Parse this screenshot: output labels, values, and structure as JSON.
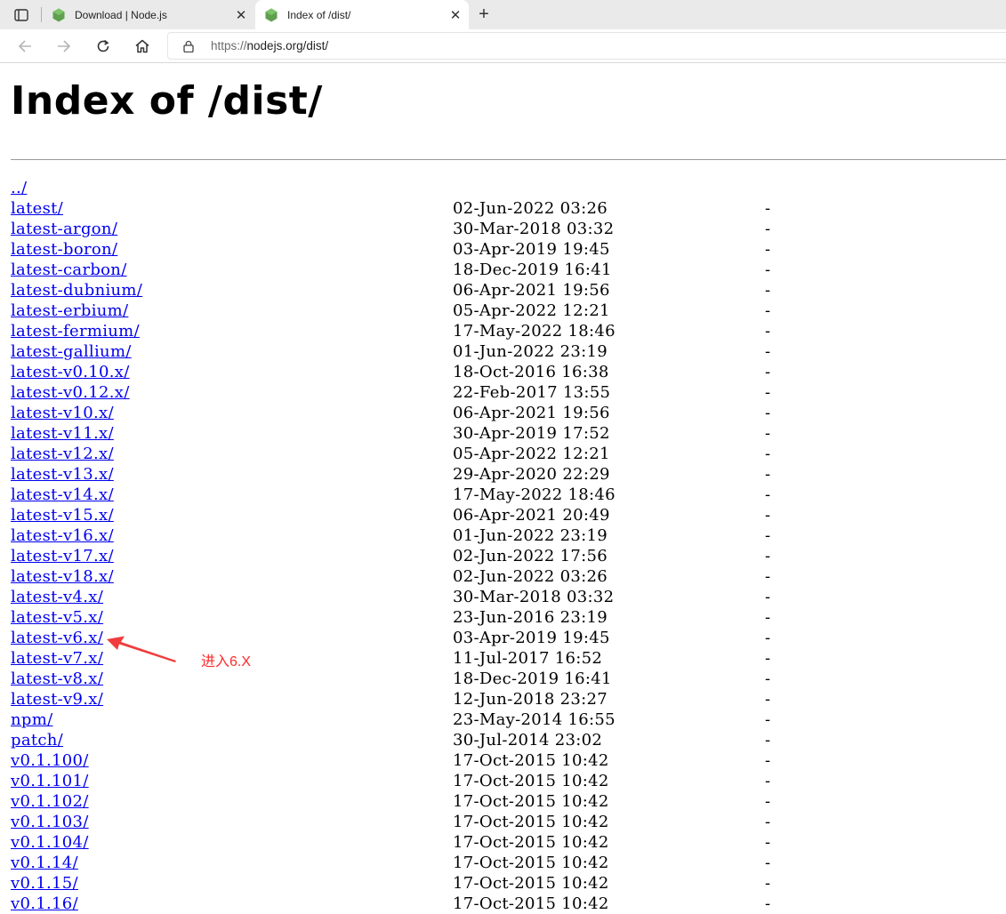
{
  "browser": {
    "tabs": [
      {
        "title": "Download | Node.js",
        "favicon": "nodejs-icon",
        "active": false
      },
      {
        "title": "Index of /dist/",
        "favicon": "nodejs-icon",
        "active": true
      }
    ],
    "address": {
      "scheme": "https://",
      "host_path": "nodejs.org/dist/"
    }
  },
  "page": {
    "title": "Index of /dist/",
    "entries": [
      {
        "name": "../",
        "date": "",
        "size": ""
      },
      {
        "name": "latest/",
        "date": "02-Jun-2022 03:26",
        "size": "-"
      },
      {
        "name": "latest-argon/",
        "date": "30-Mar-2018 03:32",
        "size": "-"
      },
      {
        "name": "latest-boron/",
        "date": "03-Apr-2019 19:45",
        "size": "-"
      },
      {
        "name": "latest-carbon/",
        "date": "18-Dec-2019 16:41",
        "size": "-"
      },
      {
        "name": "latest-dubnium/",
        "date": "06-Apr-2021 19:56",
        "size": "-"
      },
      {
        "name": "latest-erbium/",
        "date": "05-Apr-2022 12:21",
        "size": "-"
      },
      {
        "name": "latest-fermium/",
        "date": "17-May-2022 18:46",
        "size": "-"
      },
      {
        "name": "latest-gallium/",
        "date": "01-Jun-2022 23:19",
        "size": "-"
      },
      {
        "name": "latest-v0.10.x/",
        "date": "18-Oct-2016 16:38",
        "size": "-"
      },
      {
        "name": "latest-v0.12.x/",
        "date": "22-Feb-2017 13:55",
        "size": "-"
      },
      {
        "name": "latest-v10.x/",
        "date": "06-Apr-2021 19:56",
        "size": "-"
      },
      {
        "name": "latest-v11.x/",
        "date": "30-Apr-2019 17:52",
        "size": "-"
      },
      {
        "name": "latest-v12.x/",
        "date": "05-Apr-2022 12:21",
        "size": "-"
      },
      {
        "name": "latest-v13.x/",
        "date": "29-Apr-2020 22:29",
        "size": "-"
      },
      {
        "name": "latest-v14.x/",
        "date": "17-May-2022 18:46",
        "size": "-"
      },
      {
        "name": "latest-v15.x/",
        "date": "06-Apr-2021 20:49",
        "size": "-"
      },
      {
        "name": "latest-v16.x/",
        "date": "01-Jun-2022 23:19",
        "size": "-"
      },
      {
        "name": "latest-v17.x/",
        "date": "02-Jun-2022 17:56",
        "size": "-"
      },
      {
        "name": "latest-v18.x/",
        "date": "02-Jun-2022 03:26",
        "size": "-"
      },
      {
        "name": "latest-v4.x/",
        "date": "30-Mar-2018 03:32",
        "size": "-"
      },
      {
        "name": "latest-v5.x/",
        "date": "23-Jun-2016 23:19",
        "size": "-"
      },
      {
        "name": "latest-v6.x/",
        "date": "03-Apr-2019 19:45",
        "size": "-"
      },
      {
        "name": "latest-v7.x/",
        "date": "11-Jul-2017 16:52",
        "size": "-"
      },
      {
        "name": "latest-v8.x/",
        "date": "18-Dec-2019 16:41",
        "size": "-"
      },
      {
        "name": "latest-v9.x/",
        "date": "12-Jun-2018 23:27",
        "size": "-"
      },
      {
        "name": "npm/",
        "date": "23-May-2014 16:55",
        "size": "-"
      },
      {
        "name": "patch/",
        "date": "30-Jul-2014 23:02",
        "size": "-"
      },
      {
        "name": "v0.1.100/",
        "date": "17-Oct-2015 10:42",
        "size": "-"
      },
      {
        "name": "v0.1.101/",
        "date": "17-Oct-2015 10:42",
        "size": "-"
      },
      {
        "name": "v0.1.102/",
        "date": "17-Oct-2015 10:42",
        "size": "-"
      },
      {
        "name": "v0.1.103/",
        "date": "17-Oct-2015 10:42",
        "size": "-"
      },
      {
        "name": "v0.1.104/",
        "date": "17-Oct-2015 10:42",
        "size": "-"
      },
      {
        "name": "v0.1.14/",
        "date": "17-Oct-2015 10:42",
        "size": "-"
      },
      {
        "name": "v0.1.15/",
        "date": "17-Oct-2015 10:42",
        "size": "-"
      },
      {
        "name": "v0.1.16/",
        "date": "17-Oct-2015 10:42",
        "size": "-"
      }
    ]
  },
  "annotation": {
    "text": "进入6.X",
    "color": "#ff2a2a",
    "points_to": "latest-v6.x/"
  },
  "colors": {
    "link": "#0000ee",
    "nodejs_green": "#5fa04e"
  }
}
